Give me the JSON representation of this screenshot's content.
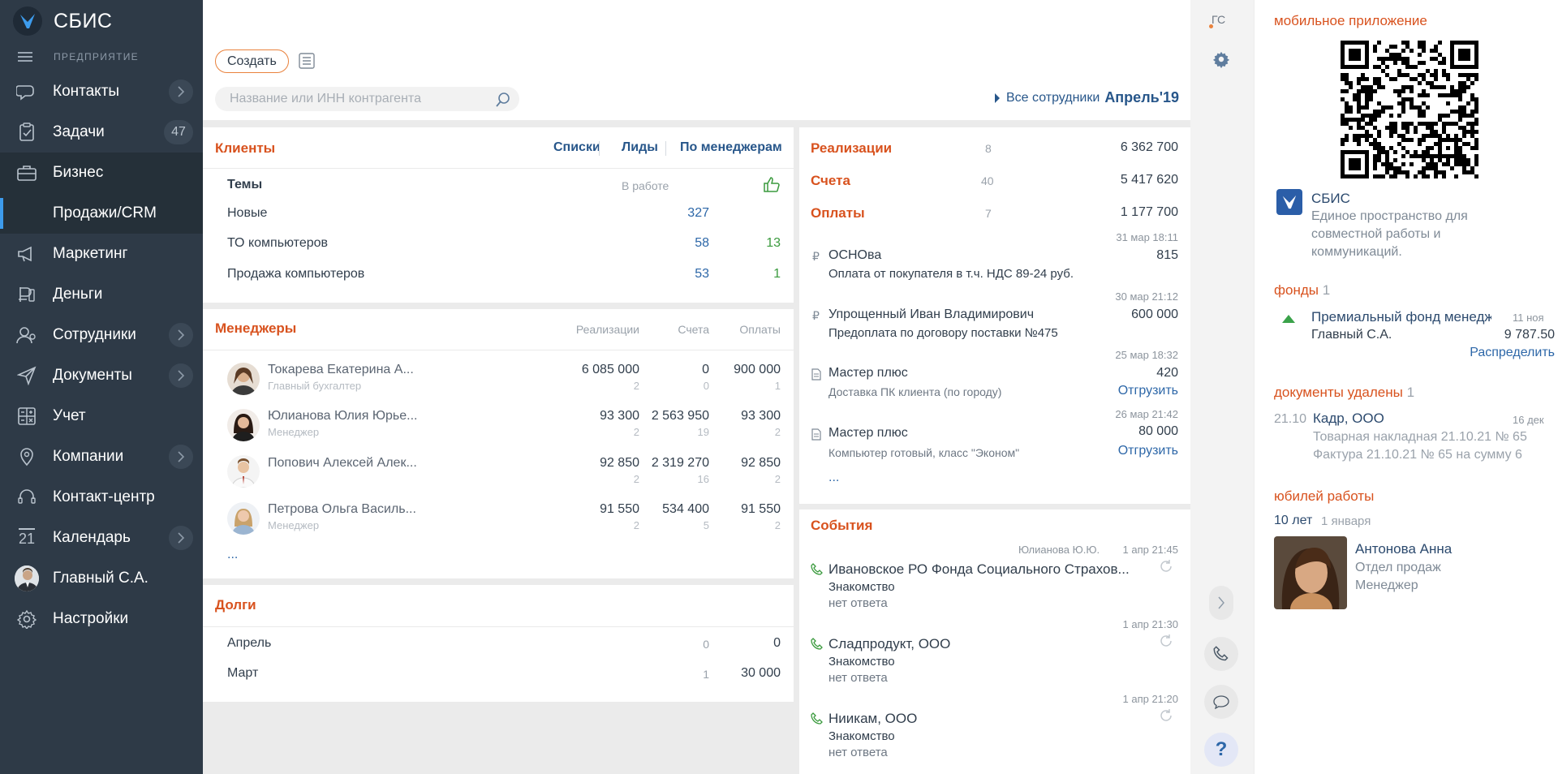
{
  "sidebar": {
    "logo_text": "СБИС",
    "org_label": "ПРЕДПРИЯТИЕ",
    "items": [
      {
        "label": "Контакты",
        "icon": "contacts-icon",
        "chevron": true
      },
      {
        "label": "Задачи",
        "icon": "tasks-icon",
        "count": "47"
      },
      {
        "label": "Бизнес",
        "icon": "briefcase-icon"
      },
      {
        "label": "Продажи/CRM"
      },
      {
        "label": "Маркетинг",
        "icon": "megaphone-icon"
      },
      {
        "label": "Деньги",
        "icon": "money-icon"
      },
      {
        "label": "Сотрудники",
        "icon": "staff-icon",
        "chevron": true
      },
      {
        "label": "Документы",
        "icon": "send-icon",
        "chevron": true
      },
      {
        "label": "Учет",
        "icon": "calculator-icon"
      },
      {
        "label": "Компании",
        "icon": "location-icon",
        "chevron": true
      },
      {
        "label": "Контакт-центр",
        "icon": "headset-icon"
      },
      {
        "label": "Календарь",
        "icon": "calendar-icon",
        "chevron": true,
        "icon_text": "21"
      },
      {
        "label": "Главный С.А.",
        "icon": "user-avatar"
      },
      {
        "label": "Настройки",
        "icon": "gear-icon"
      }
    ]
  },
  "topbar": {
    "create_label": "Создать",
    "search_placeholder": "Название или ИНН контрагента",
    "all_staff_label": "Все сотрудники",
    "period_label": "Апрель'19"
  },
  "clients": {
    "title": "Клиенты",
    "tabs": [
      "Списки",
      "Лиды",
      "По менеджерам"
    ],
    "header_topics": "Темы",
    "header_in_work": "В работе",
    "rows": [
      {
        "name": "Новые",
        "in_work": "327",
        "won": ""
      },
      {
        "name": "ТО компьютеров",
        "in_work": "58",
        "won": "13"
      },
      {
        "name": "Продажа компьютеров",
        "in_work": "53",
        "won": "1"
      }
    ]
  },
  "managers": {
    "title": "Менеджеры",
    "col_sales": "Реализации",
    "col_invoices": "Счета",
    "col_payments": "Оплаты",
    "rows": [
      {
        "name": "Токарева Екатерина А...",
        "role": "Главный бухгалтер",
        "sales": "6 085 000",
        "sales_n": "2",
        "inv": "0",
        "inv_n": "0",
        "pay": "900 000",
        "pay_n": "1"
      },
      {
        "name": "Юлианова Юлия Юрье...",
        "role": "Менеджер",
        "sales": "93 300",
        "sales_n": "2",
        "inv": "2 563 950",
        "inv_n": "19",
        "pay": "93 300",
        "pay_n": "2"
      },
      {
        "name": "Попович Алексей Алек...",
        "role": "",
        "sales": "92 850",
        "sales_n": "2",
        "inv": "2 319 270",
        "inv_n": "16",
        "pay": "92 850",
        "pay_n": "2"
      },
      {
        "name": "Петрова Ольга Василь...",
        "role": "Менеджер",
        "sales": "91 550",
        "sales_n": "2",
        "inv": "534 400",
        "inv_n": "5",
        "pay": "91 550",
        "pay_n": "2"
      }
    ],
    "more": "..."
  },
  "debts": {
    "title": "Долги",
    "rows": [
      {
        "month": "Апрель",
        "count": "0",
        "amount": "0"
      },
      {
        "month": "Март",
        "count": "1",
        "amount": "30 000"
      }
    ]
  },
  "sales": {
    "rows": [
      {
        "label": "Реализации",
        "count": "8",
        "amount": "6 362 700"
      },
      {
        "label": "Счета",
        "count": "40",
        "amount": "5 417 620"
      },
      {
        "label": "Оплаты",
        "count": "7",
        "amount": "1 177 700"
      }
    ],
    "items": [
      {
        "icon": "ruble-icon",
        "time": "31 мар 18:11",
        "name": "ОСНОва",
        "amount": "815",
        "desc": "Оплата от покупателя в т.ч. НДС 89-24 руб.",
        "action": ""
      },
      {
        "icon": "ruble-icon",
        "time": "30 мар 21:12",
        "name": "Упрощенный Иван Владимирович",
        "amount": "600 000",
        "desc": "Предоплата по договору поставки №475",
        "action": ""
      },
      {
        "icon": "document-icon",
        "time": "25 мар 18:32",
        "name": "Мастер плюс",
        "amount": "420",
        "desc": "Доставка ПК клиента (по городу)",
        "action": "Отгрузить"
      },
      {
        "icon": "document-icon",
        "time": "26 мар 21:42",
        "name": "Мастер плюс",
        "amount": "80 000",
        "desc": "Компьютер готовый, класс \"Эконом\"",
        "action": "Отгрузить"
      }
    ],
    "more": "..."
  },
  "events": {
    "title": "События",
    "items": [
      {
        "author": "Юлианова Ю.Ю.",
        "time": "1 апр 21:45",
        "name": "Ивановское РО Фонда Социального Страхов...",
        "type": "Знакомство",
        "result": "нет ответа"
      },
      {
        "author": "",
        "time": "1 апр 21:30",
        "name": "Сладпродукт, ООО",
        "type": "Знакомство",
        "result": "нет ответа"
      },
      {
        "author": "",
        "time": "1 апр 21:20",
        "name": "Ниикам, ООО",
        "type": "Знакомство",
        "result": "нет ответа"
      }
    ]
  },
  "toolstrip": {
    "user_initials": "ГС"
  },
  "rpanel": {
    "mobile_title": "мобильное приложение",
    "app_name": "СБИС",
    "app_desc_1": "Единое пространство для",
    "app_desc_2": "совместной работы и",
    "app_desc_3": "коммуникаций.",
    "funds_title": "фонды",
    "funds_count": "1",
    "fund_name": "Премиальный фонд менедж",
    "fund_date": "11 ноя",
    "fund_owner": "Главный С.А.",
    "fund_amount": "9 787.50",
    "fund_action": "Распределить",
    "deleted_title": "документы удалены",
    "deleted_count": "1",
    "deleted_date": "21.10",
    "deleted_company": "Кадр, ООО",
    "deleted_company_date": "16 дек",
    "deleted_doc_1": "Товарная накладная 21.10.21 № 65",
    "deleted_doc_2": "Фактура 21.10.21 № 65 на сумму 6",
    "jubilee_title": "юбилей работы",
    "jubilee_years": "10 лет",
    "jubilee_date": "1 января",
    "person_name": "Антонова Анна",
    "person_dept": "Отдел продаж",
    "person_role": "Менеджер"
  },
  "colors": {
    "sidebar_bg": "#2e3a47",
    "accent_orange": "#d8521e",
    "link_blue": "#2d67a8",
    "positive_green": "#3a9a3d"
  }
}
